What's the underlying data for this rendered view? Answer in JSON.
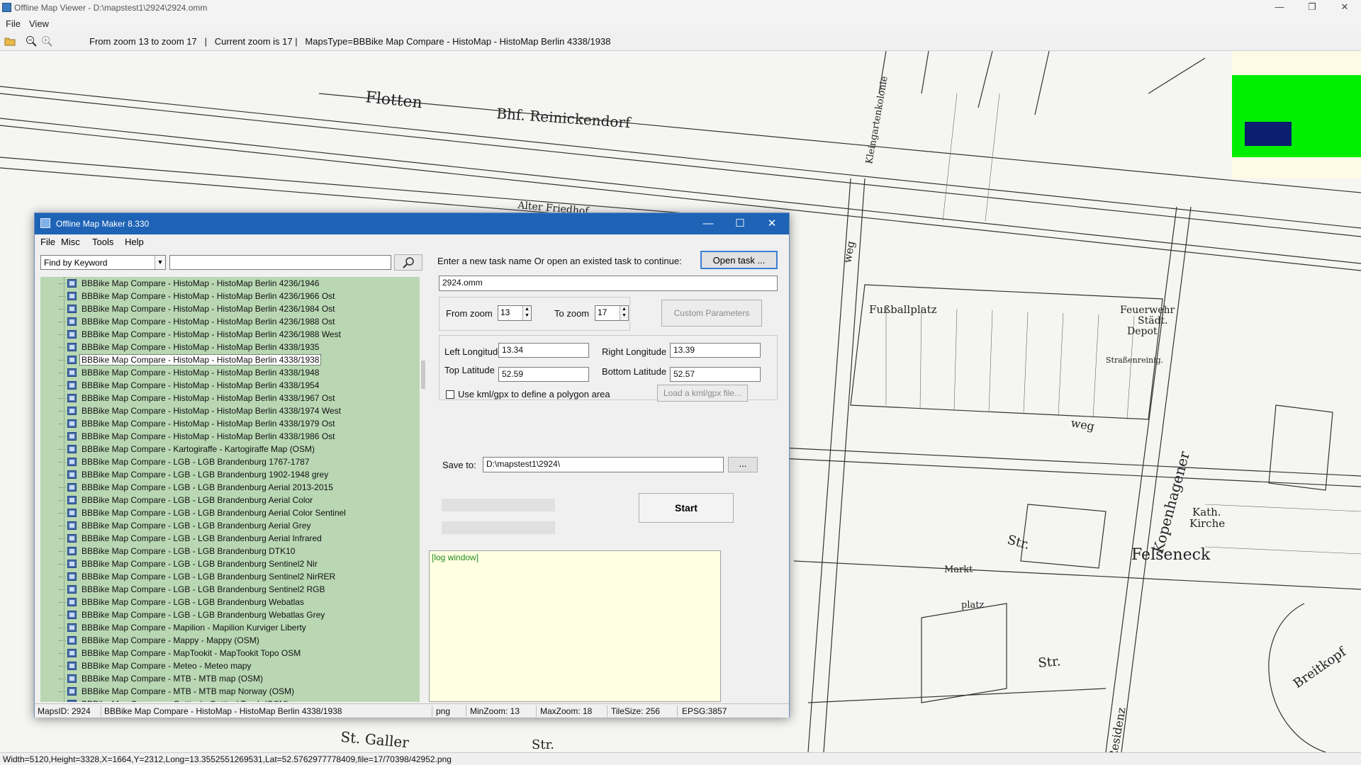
{
  "viewer": {
    "title": "Offline Map Viewer - D:\\mapstest1\\2924\\2924.omm",
    "menu": [
      "File",
      "View"
    ],
    "toolbar_status": "From zoom 13 to zoom 17   |   Current zoom is 17 |   MapsType=BBBike Map Compare - HistoMap - HistoMap Berlin 4338/1938",
    "status_bar": "Width=5120,Height=3328,X=1664,Y=2312,Long=13.3552551269531,Lat=52.5762977778409,file=17/70398/42952.png",
    "window_controls": {
      "minimize": "—",
      "maximize": "❐",
      "close": "✕"
    }
  },
  "map": {
    "labels": [
      "Flotten",
      "Bhf. Reinickendorf",
      "Alter Friedhof",
      "Kleingartenkolonie",
      "Fußballplatz",
      "Feuerwehr Städt. Depot",
      "Straßenreinig.",
      "weg",
      "Kopenhagener",
      "Str.",
      "Kath. Kirche",
      "Felseneck",
      "Markt-",
      "platz",
      "Str.",
      "Residenz",
      "Breitkopf",
      "St. Galler",
      "Str."
    ]
  },
  "maker": {
    "title": "Offline Map Maker 8.330",
    "window_controls": {
      "minimize": "—",
      "maximize": "☐",
      "close": "✕"
    },
    "menu": [
      "File",
      "Misc",
      "Tools",
      "Help"
    ],
    "find": {
      "mode": "Find by Keyword",
      "query": ""
    },
    "tree_items": [
      "BBBike Map Compare - HistoMap - HistoMap Berlin 4236/1946",
      "BBBike Map Compare - HistoMap - HistoMap Berlin 4236/1966 Ost",
      "BBBike Map Compare - HistoMap - HistoMap Berlin 4236/1984 Ost",
      "BBBike Map Compare - HistoMap - HistoMap Berlin 4236/1988 Ost",
      "BBBike Map Compare - HistoMap - HistoMap Berlin 4236/1988 West",
      "BBBike Map Compare - HistoMap - HistoMap Berlin 4338/1935",
      "BBBike Map Compare - HistoMap - HistoMap Berlin 4338/1938",
      "BBBike Map Compare - HistoMap - HistoMap Berlin 4338/1948",
      "BBBike Map Compare - HistoMap - HistoMap Berlin 4338/1954",
      "BBBike Map Compare - HistoMap - HistoMap Berlin 4338/1967 Ost",
      "BBBike Map Compare - HistoMap - HistoMap Berlin 4338/1974 West",
      "BBBike Map Compare - HistoMap - HistoMap Berlin 4338/1979 Ost",
      "BBBike Map Compare - HistoMap - HistoMap Berlin 4338/1986 Ost",
      "BBBike Map Compare - Kartogiraffe - Kartogiraffe Map (OSM)",
      "BBBike Map Compare - LGB - LGB Brandenburg 1767-1787",
      "BBBike Map Compare - LGB - LGB Brandenburg 1902-1948 grey",
      "BBBike Map Compare - LGB - LGB Brandenburg Aerial 2013-2015",
      "BBBike Map Compare - LGB - LGB Brandenburg Aerial Color",
      "BBBike Map Compare - LGB - LGB Brandenburg Aerial Color Sentinel",
      "BBBike Map Compare - LGB - LGB Brandenburg Aerial Grey",
      "BBBike Map Compare - LGB - LGB Brandenburg Aerial Infrared",
      "BBBike Map Compare - LGB - LGB Brandenburg DTK10",
      "BBBike Map Compare - LGB - LGB Brandenburg Sentinel2 Nir",
      "BBBike Map Compare - LGB - LGB Brandenburg Sentinel2 NirRER",
      "BBBike Map Compare - LGB - LGB Brandenburg Sentinel2 RGB",
      "BBBike Map Compare - LGB - LGB Brandenburg Webatlas",
      "BBBike Map Compare - LGB - LGB Brandenburg Webatlas Grey",
      "BBBike Map Compare - Mapilion - Mapilion Kurviger Liberty",
      "BBBike Map Compare - Mappy - Mappy (OSM)",
      "BBBike Map Compare - MapTookit - MapTookit Topo OSM",
      "BBBike Map Compare - Meteo - Meteo mapy",
      "BBBike Map Compare - MTB - MTB map (OSM)",
      "BBBike Map Compare - MTB - MTB map Norway (OSM)",
      "BBBike Map Compare - Opttical - Opttical Truck (OSM)"
    ],
    "selected_index": 6,
    "task": {
      "prompt": "Enter a new task name Or open an existed task to continue:",
      "open_button": "Open task ...",
      "name": "2924.omm"
    },
    "zoom": {
      "from_label": "From zoom",
      "from_value": "13",
      "to_label": "To zoom",
      "to_value": "17",
      "custom_button": "Custom Parameters"
    },
    "bounds": {
      "left_lon_label": "Left Longitude",
      "left_lon": "13.34",
      "right_lon_label": "Right Longitude",
      "right_lon": "13.39",
      "top_lat_label": "Top Latitude",
      "top_lat": "52.59",
      "bottom_lat_label": "Bottom Latitude",
      "bottom_lat": "52.57",
      "kml_label": "Use kml/gpx to define a polygon area",
      "kml_button": "Load a kml/gpx file..."
    },
    "save": {
      "label": "Save to:",
      "path": "D:\\mapstest1\\2924\\",
      "browse": "..."
    },
    "start_button": "Start",
    "log": "[log window]",
    "status": {
      "maps_id": "MapsID: 2924",
      "maps_name": "BBBike Map Compare - HistoMap - HistoMap Berlin 4338/1938",
      "format": "png",
      "min_zoom": "MinZoom: 13",
      "max_zoom": "MaxZoom: 18",
      "tile_size": "TileSize: 256",
      "epsg": "EPSG:3857"
    }
  },
  "colors": {
    "tree_bg": "#b9d7b3",
    "title_blue": "#1e63b6",
    "overview_green": "#00ee00",
    "overview_blue": "#0a1f6f",
    "log_bg": "#ffffe1"
  }
}
